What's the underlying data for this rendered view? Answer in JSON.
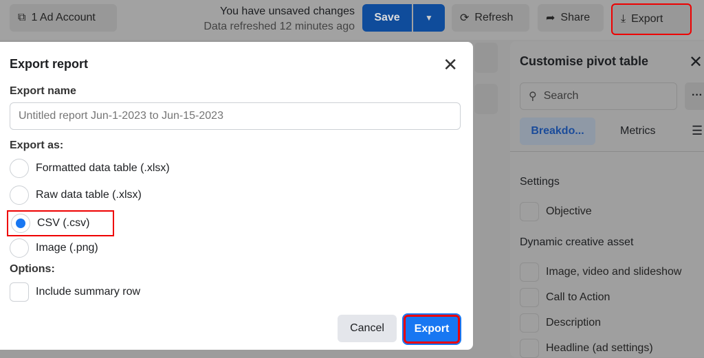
{
  "topbar": {
    "ad_account": "1 Ad Account",
    "status_line1": "You have unsaved changes",
    "status_line2": "Data refreshed 12 minutes ago",
    "save": "Save",
    "refresh": "Refresh",
    "share": "Share",
    "export": "Export"
  },
  "pivot": {
    "title": "Customise pivot table",
    "search_placeholder": "Search",
    "tabs": [
      "Breakdo...",
      "Metrics"
    ],
    "section1": "Settings",
    "item_objective": "Objective",
    "section2": "Dynamic creative asset",
    "items": [
      "Image, video and slideshow",
      "Call to Action",
      "Description",
      "Headline (ad settings)"
    ]
  },
  "modal": {
    "title": "Export report",
    "name_label": "Export name",
    "name_placeholder": "Untitled report Jun-1-2023 to Jun-15-2023",
    "export_as_label": "Export as:",
    "formats": [
      {
        "label": "Formatted data table (.xlsx)",
        "selected": false
      },
      {
        "label": "Raw data table (.xlsx)",
        "selected": false
      },
      {
        "label": "CSV (.csv)",
        "selected": true
      },
      {
        "label": "Image (.png)",
        "selected": false
      }
    ],
    "options_label": "Options:",
    "include_summary": "Include summary row",
    "include_summary_checked": false,
    "cancel": "Cancel",
    "export": "Export"
  },
  "colors": {
    "accent": "#1877f2",
    "highlight": "#e00000"
  }
}
